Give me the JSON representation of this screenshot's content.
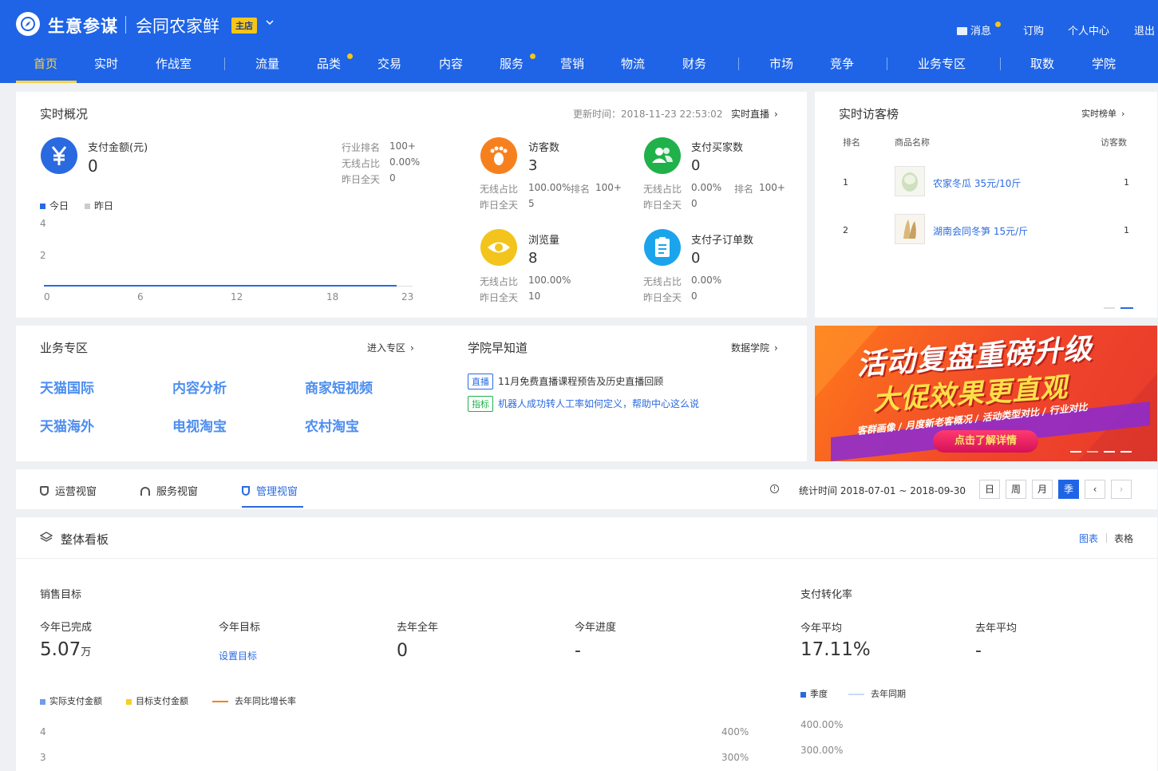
{
  "header": {
    "brand": "生意参谋",
    "shop_name": "会同农家鲜",
    "shop_badge": "主店",
    "top_links": {
      "messages": "消息",
      "subscribe": "订购",
      "personal": "个人中心",
      "logout": "退出"
    },
    "nav": [
      "首页",
      "实时",
      "作战室",
      "流量",
      "品类",
      "交易",
      "内容",
      "服务",
      "营销",
      "物流",
      "财务",
      "市场",
      "竞争",
      "业务专区",
      "取数",
      "学院"
    ]
  },
  "realtime": {
    "title": "实时概况",
    "update_time": "更新时间：2018-11-23 22:53:02",
    "live_link": "实时直播",
    "pay": {
      "label": "支付金额(元)",
      "value": "0",
      "rank_label": "行业排名",
      "rank_value": "100+",
      "wireless_label": "无线占比",
      "wireless_value": "0.00%",
      "yesterday_label": "昨日全天",
      "yesterday_value": "0"
    },
    "legend": {
      "today": "今日",
      "yesterday": "昨日"
    },
    "chart": {
      "y_ticks": [
        "4",
        "2"
      ],
      "x_ticks": [
        "0",
        "6",
        "12",
        "18",
        "23"
      ]
    },
    "visitors": {
      "label": "访客数",
      "value": "3",
      "wireless_label": "无线占比",
      "wireless_value": "100.00%",
      "rank_label": "排名",
      "rank_value": "100+",
      "yesterday_label": "昨日全天",
      "yesterday_value": "5"
    },
    "buyers": {
      "label": "支付买家数",
      "value": "0",
      "wireless_label": "无线占比",
      "wireless_value": "0.00%",
      "rank_label": "排名",
      "rank_value": "100+",
      "yesterday_label": "昨日全天",
      "yesterday_value": "0"
    },
    "pageviews": {
      "label": "浏览量",
      "value": "8",
      "wireless_label": "无线占比",
      "wireless_value": "100.00%",
      "yesterday_label": "昨日全天",
      "yesterday_value": "10"
    },
    "suborders": {
      "label": "支付子订单数",
      "value": "0",
      "wireless_label": "无线占比",
      "wireless_value": "0.00%",
      "yesterday_label": "昨日全天",
      "yesterday_value": "0"
    }
  },
  "visitor_rank": {
    "title": "实时访客榜",
    "link": "实时榜单",
    "headers": {
      "rank": "排名",
      "name": "商品名称",
      "visitors": "访客数"
    },
    "rows": [
      {
        "rank": "1",
        "name": "农家冬瓜 35元/10斤",
        "visitors": "1"
      },
      {
        "rank": "2",
        "name": "湖南会同冬笋 15元/斤",
        "visitors": "1"
      }
    ]
  },
  "business": {
    "title": "业务专区",
    "link": "进入专区",
    "items": [
      "天猫国际",
      "内容分析",
      "商家短视频",
      "天猫海外",
      "电视淘宝",
      "农村淘宝"
    ]
  },
  "academy": {
    "title": "学院早知道",
    "link": "数据学院",
    "news": [
      {
        "tag": "直播",
        "text": "11月免费直播课程预告及历史直播回顾"
      },
      {
        "tag": "指标",
        "text": "机器人成功转人工率如何定义，帮助中心这么说"
      }
    ]
  },
  "banner": {
    "line1": "活动复盘重磅升级",
    "line2": "大促效果更直观",
    "line3": "客群画像 / 月度新老客概况 / 活动类型对比 / 行业对比",
    "button": "点击了解详情"
  },
  "tabs": {
    "items": [
      "运营视窗",
      "服务视窗",
      "管理视窗"
    ],
    "active": 2,
    "stat_time": "统计时间 2018-07-01 ~ 2018-09-30",
    "periods": [
      "日",
      "周",
      "月",
      "季"
    ],
    "active_period": 3
  },
  "dashboard": {
    "title": "整体看板",
    "view_chart": "图表",
    "view_table": "表格",
    "sales": {
      "title": "销售目标",
      "completed_label": "今年已完成",
      "completed_value": "5.07",
      "completed_unit": "万",
      "target_label": "今年目标",
      "target_link": "设置目标",
      "last_year_label": "去年全年",
      "last_year_value": "0",
      "progress_label": "今年进度",
      "progress_value": "-",
      "legend": [
        "实际支付金额",
        "目标支付金额",
        "去年同比增长率"
      ],
      "y_left": [
        "4",
        "3"
      ],
      "y_right": [
        "400%",
        "300%"
      ]
    },
    "conversion": {
      "title": "支付转化率",
      "avg_label": "今年平均",
      "avg_value": "17.11%",
      "last_avg_label": "去年平均",
      "last_avg_value": "-",
      "legend": [
        "季度",
        "去年同期"
      ],
      "y_ticks": [
        "400.00%",
        "300.00%"
      ]
    }
  },
  "colors": {
    "primary": "#1f64e6",
    "accent": "#f7d34a",
    "link": "#2a6ae0"
  }
}
